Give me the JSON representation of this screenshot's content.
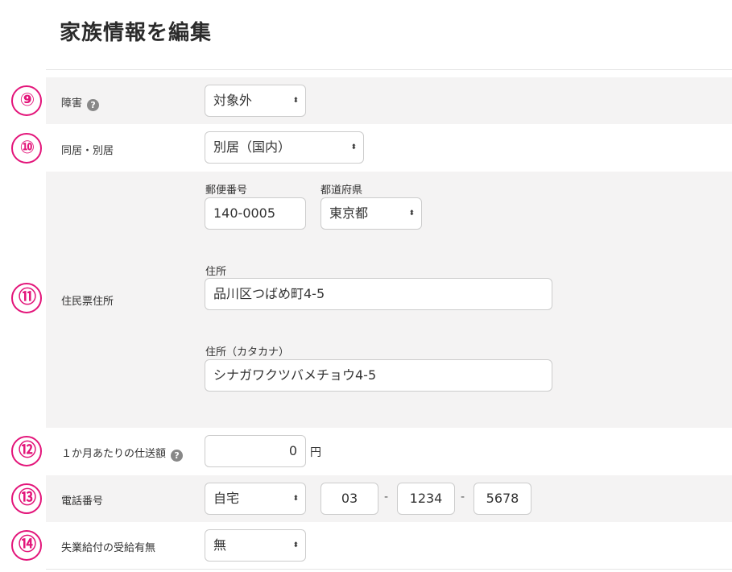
{
  "page": {
    "title": "家族情報を編集"
  },
  "rows": {
    "disability": {
      "number": "⑨",
      "label": "障害",
      "help": "?",
      "value": "対象外"
    },
    "cohabitation": {
      "number": "⑩",
      "label": "同居・別居",
      "value": "別居（国内）"
    },
    "address": {
      "number": "⑪",
      "label": "住民票住所",
      "postal_label": "郵便番号",
      "postal_value": "140-0005",
      "prefecture_label": "都道府県",
      "prefecture_value": "東京都",
      "address_label": "住所",
      "address_value": "品川区つばめ町4-5",
      "address_kana_label": "住所（カタカナ）",
      "address_kana_value": "シナガワクツバメチョウ4-5"
    },
    "allowance": {
      "number": "⑫",
      "label": "１か月あたりの仕送額",
      "help": "?",
      "value": "0",
      "unit": "円"
    },
    "phone": {
      "number": "⑬",
      "label": "電話番号",
      "type_value": "自宅",
      "part1": "03",
      "part2": "1234",
      "part3": "5678",
      "separator": "-"
    },
    "unemployment": {
      "number": "⑭",
      "label": "失業給付の受給有無",
      "value": "無"
    }
  },
  "icons": {
    "select_arrow": "updown-arrow-icon",
    "help": "question-circle-icon"
  },
  "colors": {
    "accent": "#e3157a",
    "row_gray": "#f4f3f3"
  }
}
